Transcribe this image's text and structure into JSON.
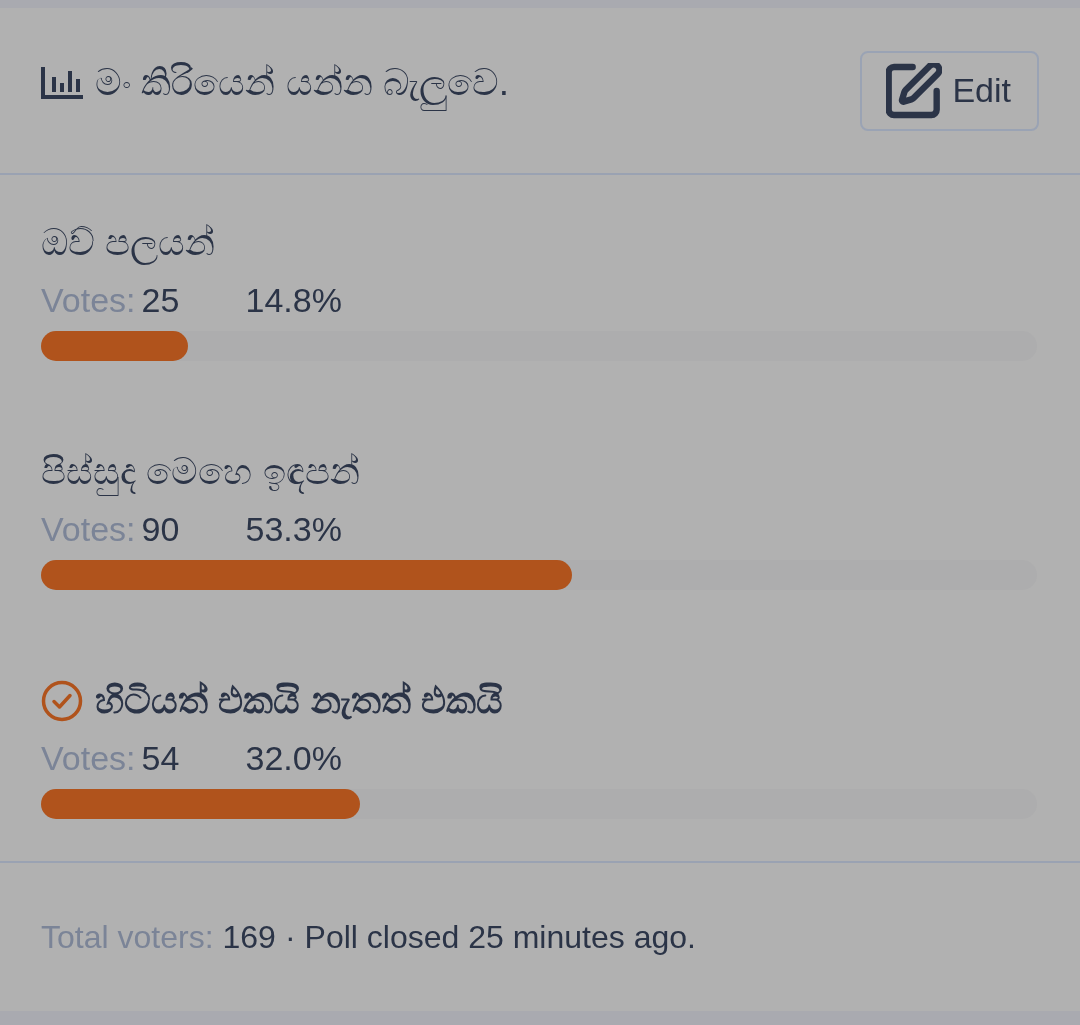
{
  "poll": {
    "title": "මං කිරියෙන් යන්න බැලුවෙ.",
    "edit_button": "Edit"
  },
  "options": [
    {
      "label": "ඔව් පලයන්",
      "votes_label": "Votes:",
      "votes": "25",
      "percent": "14.8%",
      "level": 0.148,
      "selected": false
    },
    {
      "label": "පිස්සුද මෙහෙ ඉඳපන්",
      "votes_label": "Votes:",
      "votes": "90",
      "percent": "53.3%",
      "level": 0.533,
      "selected": false
    },
    {
      "label": "හිටියත් එකයි නැතත් එකයි",
      "votes_label": "Votes:",
      "votes": "54",
      "percent": "32.0%",
      "level": 0.32,
      "selected": true
    }
  ],
  "footer": {
    "total_label": "Total voters:",
    "total": "169",
    "separator": "·",
    "status": "Poll closed 25 minutes ago."
  }
}
